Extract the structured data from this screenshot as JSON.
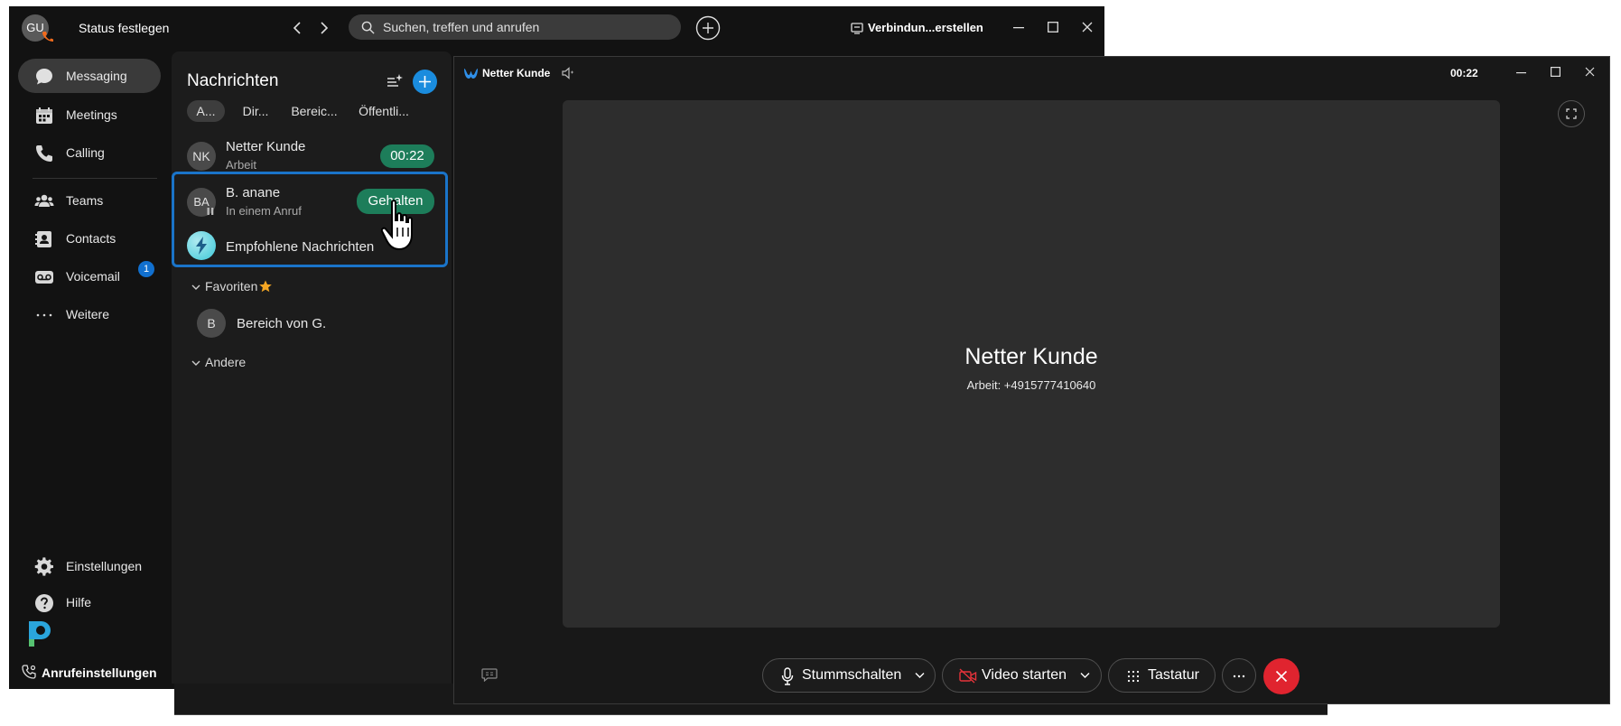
{
  "main_window": {
    "avatar_initials": "GU",
    "status_label": "Status festlegen",
    "search_placeholder": "Suchen, treffen und anrufen",
    "connect_label": "Verbindun...erstellen"
  },
  "nav": {
    "items": [
      {
        "label": "Messaging",
        "icon": "chat-bubble-icon"
      },
      {
        "label": "Meetings",
        "icon": "calendar-icon"
      },
      {
        "label": "Calling",
        "icon": "phone-icon"
      },
      {
        "label": "Teams",
        "icon": "people-icon"
      },
      {
        "label": "Contacts",
        "icon": "contact-card-icon"
      },
      {
        "label": "Voicemail",
        "icon": "voicemail-icon",
        "badge": "1"
      },
      {
        "label": "Weitere",
        "icon": "more-horizontal-icon"
      }
    ],
    "bottom": [
      {
        "label": "Einstellungen",
        "icon": "gear-icon"
      },
      {
        "label": "Hilfe",
        "icon": "help-icon"
      }
    ],
    "call_settings_label": "Anrufeinstellungen"
  },
  "panel": {
    "title": "Nachrichten",
    "filters": [
      "A...",
      "Dir...",
      "Bereic...",
      "Öffentli..."
    ],
    "conversations": [
      {
        "initials": "NK",
        "name": "Netter Kunde",
        "sub": "Arbeit",
        "badge": "00:22"
      },
      {
        "initials": "BA",
        "name": "B. anane",
        "sub": "In einem Anruf",
        "badge": "Gehalten"
      },
      {
        "name": "Empfohlene Nachrichten"
      }
    ],
    "favorites_label": "Favoriten",
    "favorites": [
      {
        "initials": "B",
        "name": "Bereich von G."
      }
    ],
    "others_label": "Andere"
  },
  "call": {
    "window_title": "Netter Kunde",
    "timer": "00:22",
    "callee_name": "Netter Kunde",
    "callee_number": "Arbeit: +4915777410640",
    "controls": {
      "mute": "Stummschalten",
      "video": "Video starten",
      "keypad": "Tastatur"
    }
  },
  "colors": {
    "accent_blue": "#1170cf",
    "selection_border": "#1a74c9",
    "call_green": "#1d7d5a",
    "end_call_red": "#e0242f"
  }
}
